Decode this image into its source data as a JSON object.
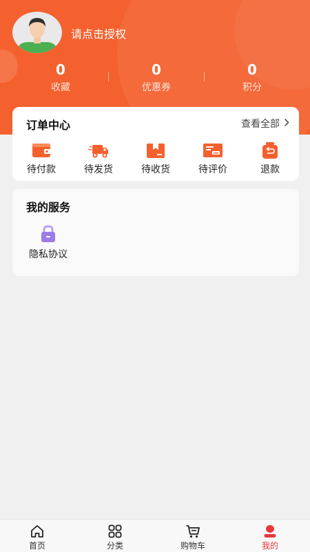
{
  "header": {
    "login_prompt": "请点击授权",
    "stats": [
      {
        "value": "0",
        "label": "收藏"
      },
      {
        "value": "0",
        "label": "优惠券"
      },
      {
        "value": "0",
        "label": "积分"
      }
    ]
  },
  "orders": {
    "title": "订单中心",
    "view_all": "查看全部",
    "items": [
      {
        "label": "待付款",
        "icon": "wallet-icon"
      },
      {
        "label": "待发货",
        "icon": "delivery-truck-icon"
      },
      {
        "label": "待收货",
        "icon": "package-box-icon"
      },
      {
        "label": "待评价",
        "icon": "review-card-icon"
      },
      {
        "label": "退款",
        "icon": "refund-bag-icon"
      }
    ]
  },
  "services": {
    "title": "我的服务",
    "items": [
      {
        "label": "隐私协议",
        "icon": "lock-icon"
      }
    ]
  },
  "tabbar": {
    "items": [
      {
        "label": "首页",
        "icon": "home-icon"
      },
      {
        "label": "分类",
        "icon": "category-grid-icon"
      },
      {
        "label": "购物车",
        "icon": "cart-icon"
      },
      {
        "label": "我的",
        "icon": "user-icon",
        "active": true
      }
    ]
  },
  "colors": {
    "brand": "#f4612f",
    "active_tab": "#e8383d",
    "service_icon": "#9b7be6"
  }
}
